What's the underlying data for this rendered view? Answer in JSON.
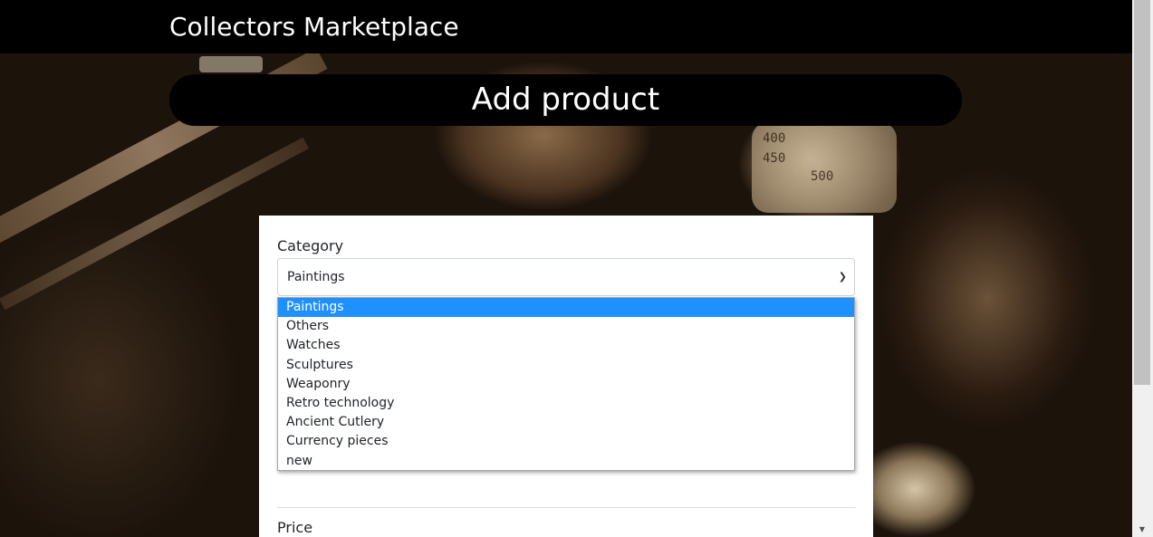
{
  "app": {
    "brand": "Collectors Marketplace",
    "page_title": "Add product"
  },
  "form": {
    "category_label": "Category",
    "category_value": "Paintings",
    "category_options": [
      {
        "label": "Paintings",
        "selected": true
      },
      {
        "label": "Others",
        "selected": false
      },
      {
        "label": "Watches",
        "selected": false
      },
      {
        "label": "Sculptures",
        "selected": false
      },
      {
        "label": "Weaponry",
        "selected": false
      },
      {
        "label": "Retro technology",
        "selected": false
      },
      {
        "label": "Ancient Cutlery",
        "selected": false
      },
      {
        "label": "Currency pieces",
        "selected": false
      },
      {
        "label": "new",
        "selected": false
      }
    ],
    "price_label": "Price"
  },
  "background": {
    "gauge_labels": [
      "400",
      "450",
      "500"
    ]
  },
  "icons": {
    "select_chevron": "chevron-down-icon",
    "scroll_down": "scroll-down-arrow-icon"
  },
  "colors": {
    "navbar": "#000000",
    "selected_option": "#1e90ff",
    "card": "#ffffff"
  }
}
